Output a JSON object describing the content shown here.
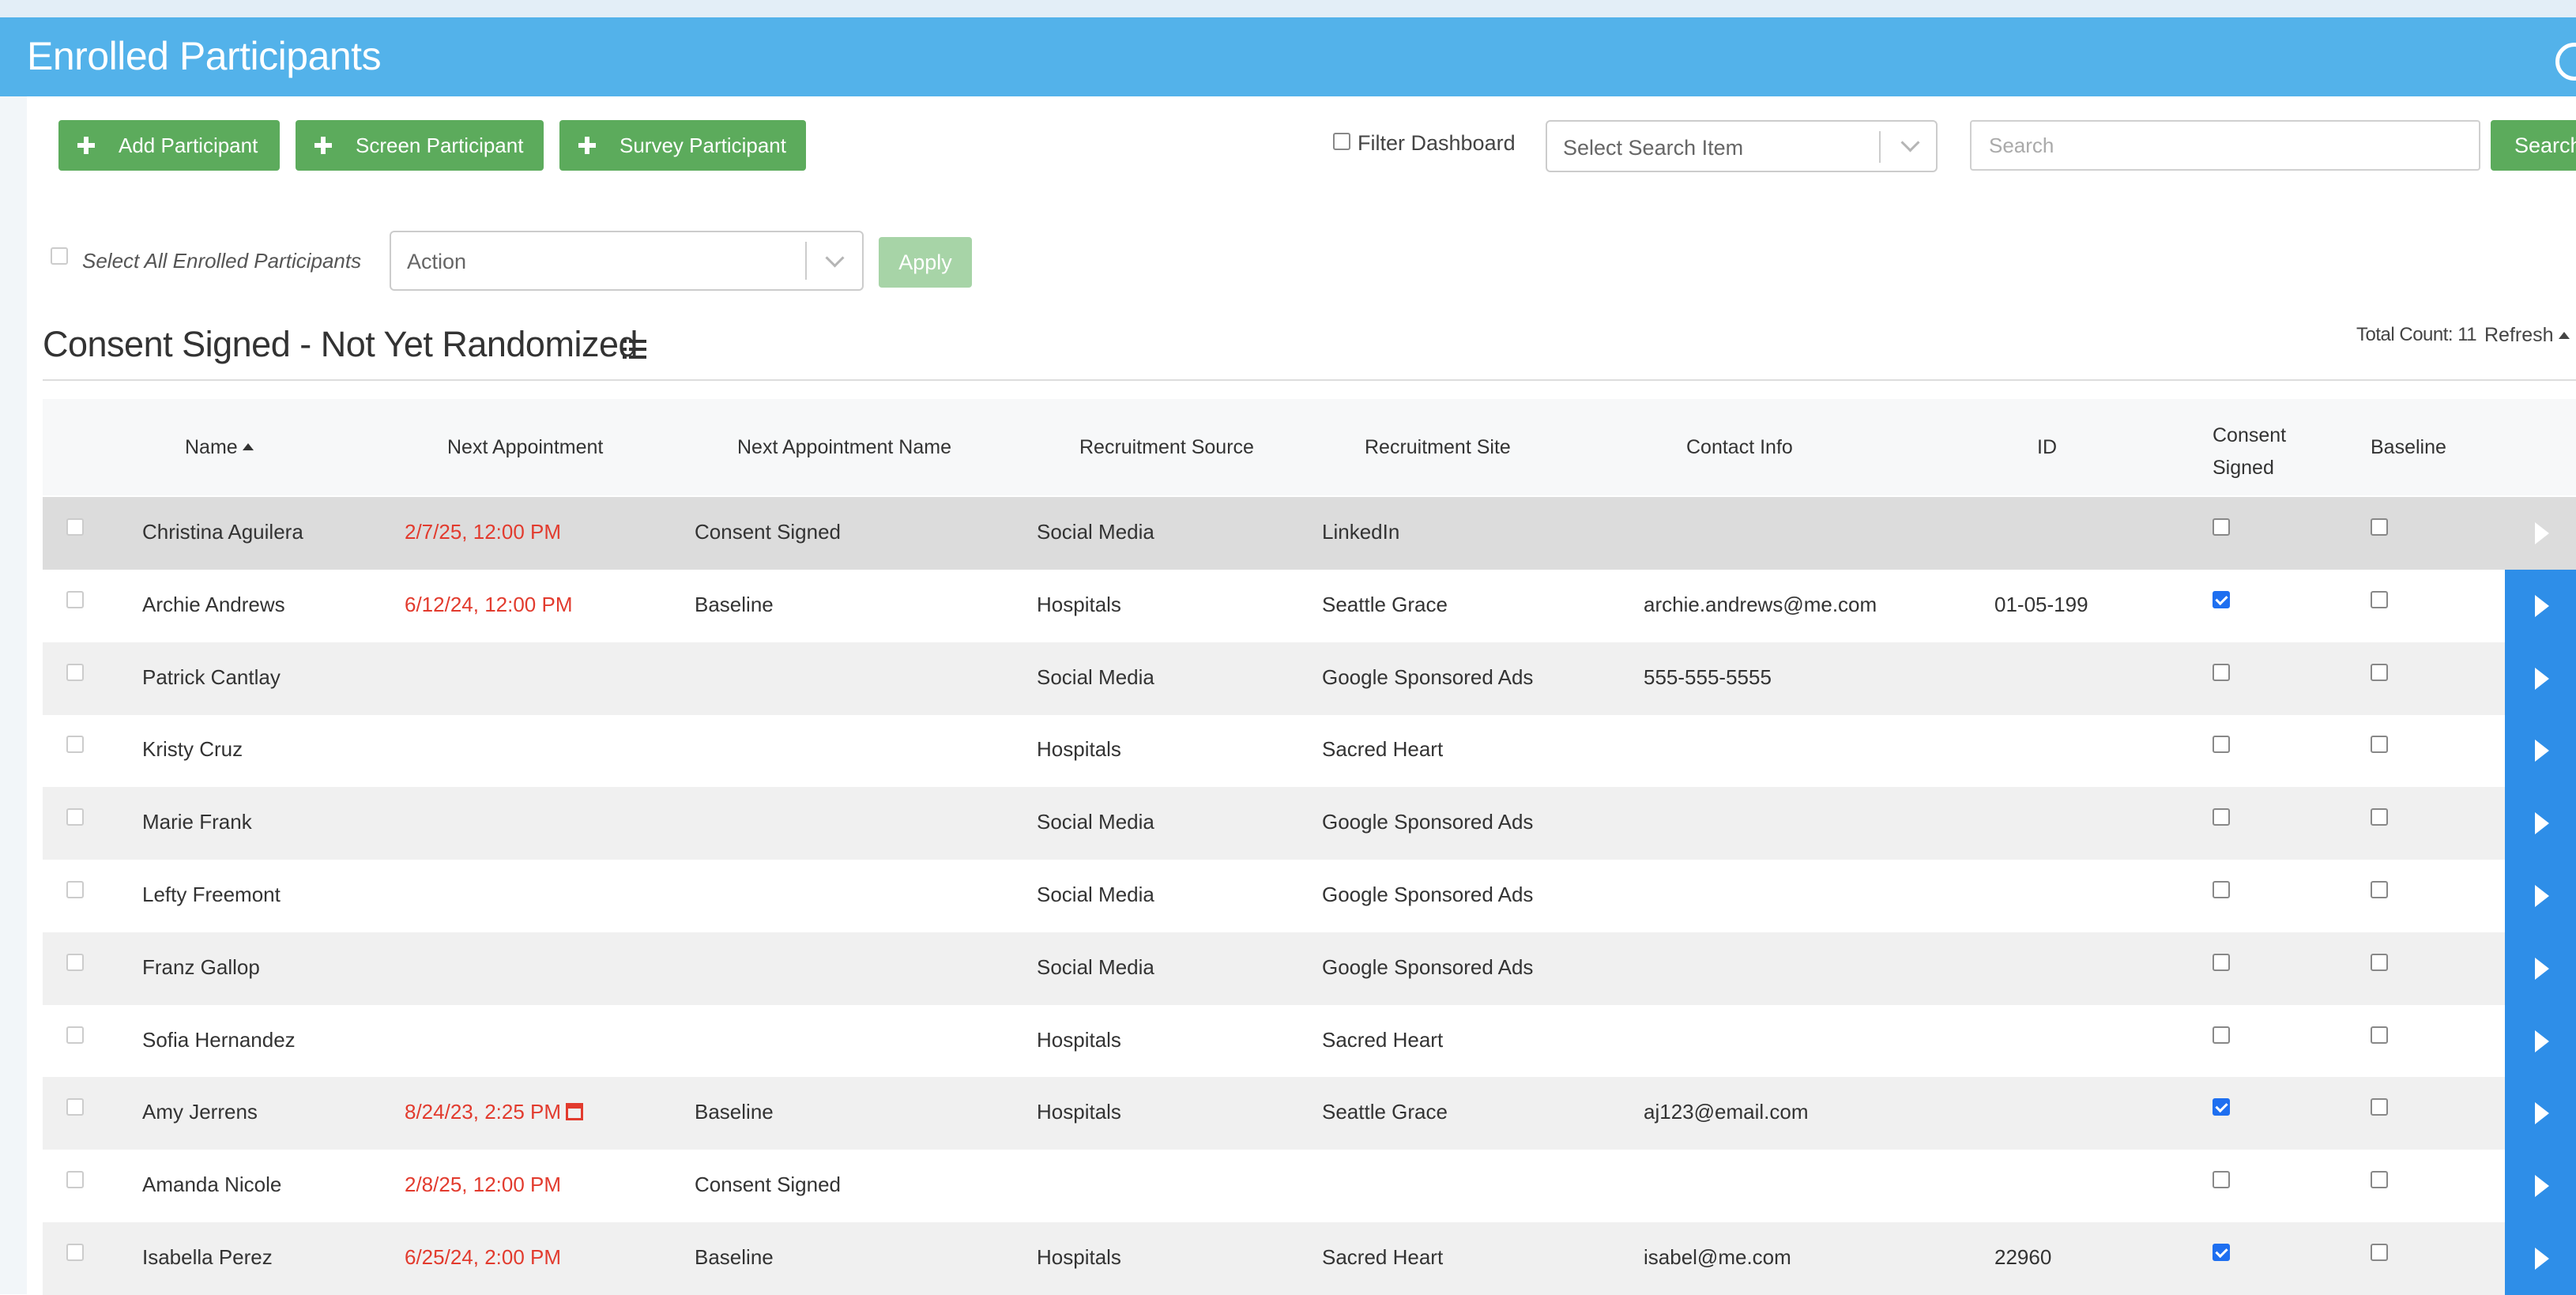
{
  "header": {
    "title": "Enrolled Participants"
  },
  "toolbar": {
    "add_participant": "Add Participant",
    "screen_participant": "Screen Participant",
    "survey_participant": "Survey Participant",
    "filter_dashboard": "Filter Dashboard",
    "search_item_placeholder": "Select Search Item",
    "search_placeholder": "Search",
    "search_button": "Search"
  },
  "bulk": {
    "select_all_label": "Select All Enrolled Participants",
    "action_placeholder": "Action",
    "apply_label": "Apply"
  },
  "section": {
    "title": "Consent Signed - Not Yet Randomized",
    "total_count": "Total Count: 11",
    "refresh": "Refresh"
  },
  "table": {
    "columns": {
      "name": "Name",
      "next_appointment": "Next Appointment",
      "next_appointment_name": "Next Appointment Name",
      "recruitment_source": "Recruitment Source",
      "recruitment_site": "Recruitment Site",
      "contact_info": "Contact Info",
      "id": "ID",
      "consent_signed_1": "Consent",
      "consent_signed_2": "Signed",
      "baseline": "Baseline"
    },
    "rows": [
      {
        "name": "Christina Aguilera",
        "next_appt": "2/7/25, 12:00 PM",
        "appt_name": "Consent Signed",
        "source": "Social Media",
        "site": "LinkedIn",
        "contact": "",
        "id": "",
        "consent": false,
        "baseline": false
      },
      {
        "name": "Archie Andrews",
        "next_appt": "6/12/24, 12:00 PM",
        "appt_name": "Baseline",
        "source": "Hospitals",
        "site": "Seattle Grace",
        "contact": "archie.andrews@me.com",
        "id": "01-05-199",
        "consent": true,
        "baseline": false
      },
      {
        "name": "Patrick Cantlay",
        "next_appt": "",
        "appt_name": "",
        "source": "Social Media",
        "site": "Google Sponsored Ads",
        "contact": "555-555-5555",
        "id": "",
        "consent": false,
        "baseline": false
      },
      {
        "name": "Kristy Cruz",
        "next_appt": "",
        "appt_name": "",
        "source": "Hospitals",
        "site": "Sacred Heart",
        "contact": "",
        "id": "",
        "consent": false,
        "baseline": false
      },
      {
        "name": "Marie Frank",
        "next_appt": "",
        "appt_name": "",
        "source": "Social Media",
        "site": "Google Sponsored Ads",
        "contact": "",
        "id": "",
        "consent": false,
        "baseline": false
      },
      {
        "name": "Lefty Freemont",
        "next_appt": "",
        "appt_name": "",
        "source": "Social Media",
        "site": "Google Sponsored Ads",
        "contact": "",
        "id": "",
        "consent": false,
        "baseline": false
      },
      {
        "name": "Franz Gallop",
        "next_appt": "",
        "appt_name": "",
        "source": "Social Media",
        "site": "Google Sponsored Ads",
        "contact": "",
        "id": "",
        "consent": false,
        "baseline": false
      },
      {
        "name": "Sofia Hernandez",
        "next_appt": "",
        "appt_name": "",
        "source": "Hospitals",
        "site": "Sacred Heart",
        "contact": "",
        "id": "",
        "consent": false,
        "baseline": false
      },
      {
        "name": "Amy Jerrens",
        "next_appt": "8/24/23, 2:25 PM",
        "appt_name": "Baseline",
        "source": "Hospitals",
        "site": "Seattle Grace",
        "contact": "aj123@email.com",
        "id": "",
        "consent": true,
        "baseline": false,
        "calendar_icon": true
      },
      {
        "name": "Amanda Nicole",
        "next_appt": "2/8/25, 12:00 PM",
        "appt_name": "Consent Signed",
        "source": "",
        "site": "",
        "contact": "",
        "id": "",
        "consent": false,
        "baseline": false
      },
      {
        "name": "Isabella Perez",
        "next_appt": "6/25/24, 2:00 PM",
        "appt_name": "Baseline",
        "source": "Hospitals",
        "site": "Sacred Heart",
        "contact": "isabel@me.com",
        "id": "22960",
        "consent": true,
        "baseline": false
      }
    ]
  },
  "colors": {
    "header_bg": "#53b2ea",
    "green_button": "#5cab5c",
    "date_red": "#e23b2e",
    "row_action_blue": "#2e8ee8"
  },
  "icons": [
    "plus-icon",
    "chevron-down-icon",
    "list-icon",
    "sort-ascending-icon",
    "caret-up-icon",
    "calendar-icon",
    "play-arrow-icon"
  ]
}
